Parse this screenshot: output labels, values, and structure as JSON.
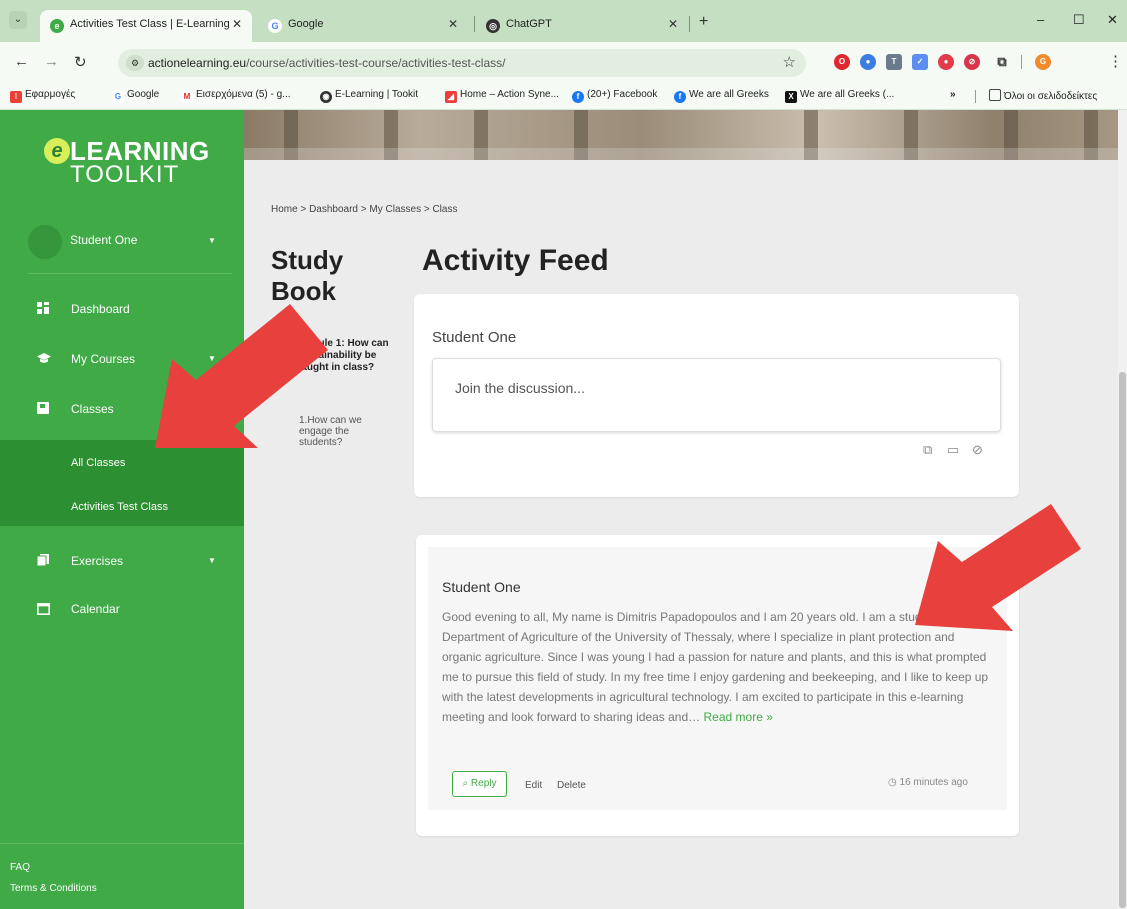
{
  "browser": {
    "tabs": [
      {
        "label": "Activities Test Class | E-Learning",
        "close": "✕",
        "active": true
      },
      {
        "label": "Google",
        "close": "✕",
        "active": false
      },
      {
        "label": "ChatGPT",
        "close": "✕",
        "active": false
      }
    ],
    "new_tab": "+",
    "window_controls": {
      "minimize": "–",
      "maximize": "☐",
      "close": "✕"
    },
    "url_domain": "actionelearning.eu",
    "url_path": "/course/activities-test-course/activities-test-class/",
    "bookmarks": [
      "Εφαρμογές",
      "Google",
      "Εισερχόμενα (5) - g...",
      "E-Learning | Tookit",
      "Home – Action Syne...",
      "(20+) Facebook",
      "We are all Greeks",
      "We are all Greeks (...",
      "»",
      "Όλοι οι σελιδοδείκτες"
    ],
    "profile_initial": "G"
  },
  "sidebar": {
    "logo_line1": "LEARNING",
    "logo_line2": "TOOLKIT",
    "logo_e": "e",
    "user_name": "Student One",
    "nav": [
      {
        "label": "Dashboard",
        "icon": "dashboard-icon"
      },
      {
        "label": "My Courses",
        "icon": "graduation-cap-icon"
      },
      {
        "label": "Classes",
        "icon": "classes-icon"
      },
      {
        "label": "Exercises",
        "icon": "exercises-icon"
      },
      {
        "label": "Calendar",
        "icon": "calendar-icon"
      }
    ],
    "sub_items": [
      "All Classes",
      "Activities Test Class"
    ],
    "footer_links": [
      "FAQ",
      "Terms & Conditions"
    ]
  },
  "main": {
    "breadcrumb": "Home > Dashboard > My Classes > Class",
    "study_book_title": "Study Book",
    "module_title": "Module 1: How can sustainability be taught in class?",
    "lesson": "1.How can we engage the students?",
    "feed_title": "Activity Feed",
    "composer": {
      "name": "Student One",
      "placeholder": "Join the discussion..."
    },
    "post": {
      "author": "Student One",
      "body": "Good evening to all, My name is Dimitris Papadopoulos and I am 20 years old. I am a student at the Department of Agriculture of the University of Thessaly, where I specialize in plant protection and organic agriculture. Since I was young I had a passion for nature and plants, and this is what prompted me to pursue this field of study. In my free time I enjoy gardening and beekeeping, and I like to keep up with the latest developments in agricultural technology. I am excited to participate in this e-learning meeting and look forward to sharing ideas and…",
      "read_more": "Read more »",
      "reply_label": "Reply",
      "edit_label": "Edit",
      "delete_label": "Delete",
      "time": "16 minutes ago"
    }
  },
  "colors": {
    "sidebar_green": "#3faa46",
    "sidebar_active": "#2c8f31",
    "arrow_red": "#e8413d"
  }
}
